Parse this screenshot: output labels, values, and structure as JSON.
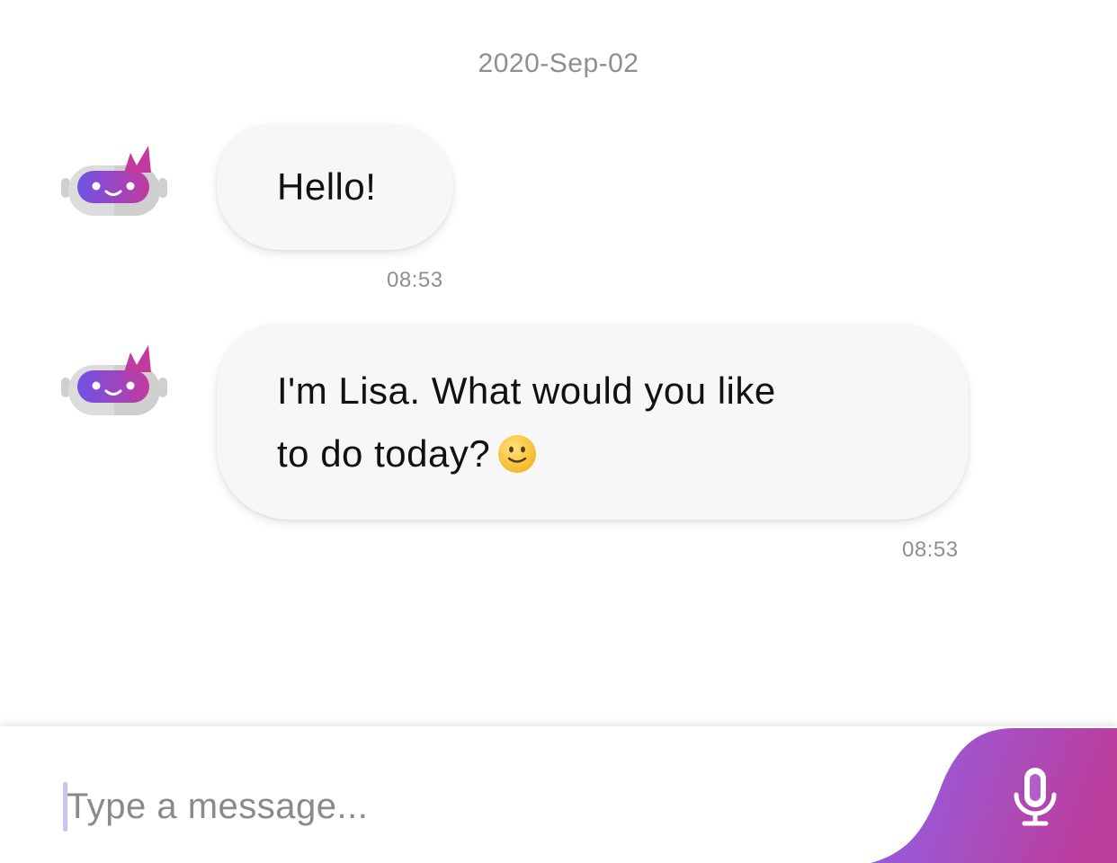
{
  "chat": {
    "date": "2020-Sep-02",
    "messages": [
      {
        "sender": "bot",
        "lines": [
          "Hello!"
        ],
        "time": "08:53"
      },
      {
        "sender": "bot",
        "lines": [
          "I'm Lisa. What would you like",
          "to do today?"
        ],
        "emoji": "slightly-smiling-face",
        "time": "08:53"
      }
    ]
  },
  "composer": {
    "placeholder": "Type a message...",
    "value": "",
    "mic_icon": "microphone-icon"
  },
  "colors": {
    "bubble_background": "#f7f7f7",
    "muted_text": "#8e8e93",
    "brand_purple": "#7b5cf0",
    "brand_magenta": "#b83fa0"
  }
}
